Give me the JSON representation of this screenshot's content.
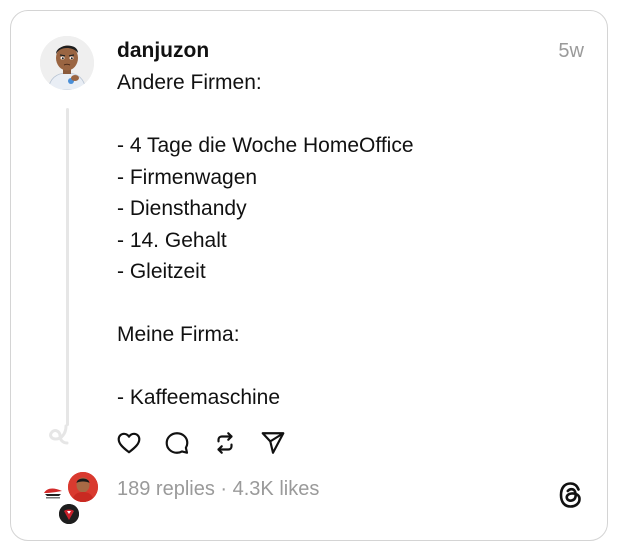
{
  "post": {
    "username": "danjuzon",
    "time": "5w",
    "lines": [
      "Andere Firmen:",
      "",
      "- 4 Tage die Woche HomeOffice",
      "- Firmenwagen",
      "- Diensthandy",
      "- 14. Gehalt",
      "- Gleitzeit",
      "",
      "Meine Firma:",
      "",
      "- Kaffeemaschine"
    ]
  },
  "actions": {
    "icons": [
      "heart-icon",
      "comment-icon",
      "repost-icon",
      "share-icon"
    ]
  },
  "stats": {
    "text": "189 replies · 4.3K likes"
  },
  "brand": {
    "logo": "threads-logo"
  }
}
